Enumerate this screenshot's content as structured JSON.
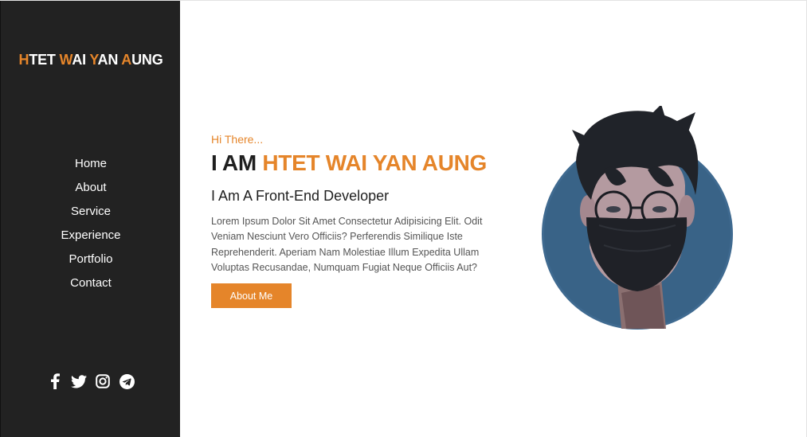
{
  "sidebar": {
    "logo": [
      {
        "accent": "H",
        "rest": "TET "
      },
      {
        "accent": "W",
        "rest": "AI "
      },
      {
        "accent": "Y",
        "rest": "AN "
      },
      {
        "accent": "A",
        "rest": "UNG"
      }
    ],
    "nav": [
      "Home",
      "About",
      "Service",
      "Experience",
      "Portfolio",
      "Contact"
    ],
    "social": [
      "facebook-icon",
      "twitter-icon",
      "instagram-icon",
      "telegram-icon"
    ]
  },
  "hero": {
    "greeting": "Hi There...",
    "headline_prefix": "I AM ",
    "headline_name": "HTET WAI YAN AUNG",
    "role": "I Am A Front-End Developer",
    "description": "Lorem Ipsum Dolor Sit Amet Consectetur Adipisicing Elit. Odit Veniam Nesciunt Vero Officiis? Perferendis Similique Iste Reprehenderit. Aperiam Nam Molestiae Illum Expedita Ullam Voluptas Recusandae, Numquam Fugiat Neque Officiis Aut?",
    "button_label": "About Me"
  },
  "colors": {
    "accent": "#e5852a",
    "sidebar_bg": "#222222",
    "avatar_circle": "#3f6a90"
  }
}
